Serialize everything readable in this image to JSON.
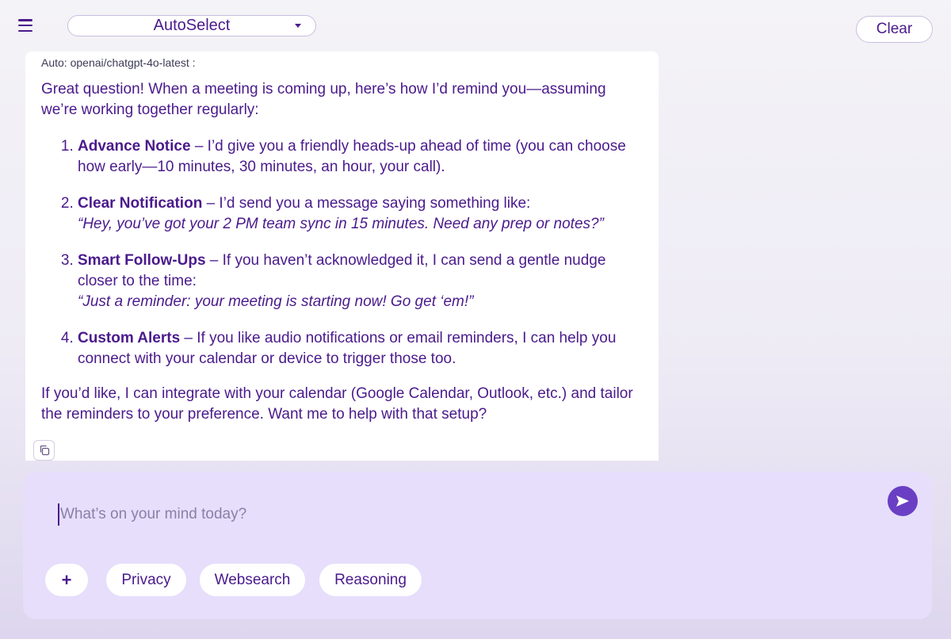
{
  "header": {
    "model_label": "AutoSelect",
    "clear_label": "Clear"
  },
  "message": {
    "model_tag": "Auto: openai/chatgpt-4o-latest :",
    "intro": "Great question! When a meeting is coming up, here’s how I’d remind you—assuming we’re working together regularly:",
    "steps": [
      {
        "title": "Advance Notice",
        "text": " – I’d give you a friendly heads-up ahead of time (you can choose how early—10 minutes, 30 minutes, an hour, your call).",
        "quote": ""
      },
      {
        "title": "Clear Notification",
        "text": " – I’d send you a message saying something like:",
        "quote": "“Hey, you’ve got your 2 PM team sync in 15 minutes. Need any prep or notes?”"
      },
      {
        "title": "Smart Follow-Ups",
        "text": " – If you haven’t acknowledged it, I can send a gentle nudge closer to the time:",
        "quote": "“Just a reminder: your meeting is starting now! Go get ‘em!”"
      },
      {
        "title": "Custom Alerts",
        "text": " – If you like audio notifications or email reminders, I can help you connect with your calendar or device to trigger those too.",
        "quote": ""
      }
    ],
    "outro": "If you’d like, I can integrate with your calendar (Google Calendar, Outlook, etc.) and tailor the reminders to your preference. Want me to help with that setup?"
  },
  "composer": {
    "placeholder": "What’s on your mind today?",
    "value": "",
    "add_label": "+",
    "chips": [
      "Privacy",
      "Websearch",
      "Reasoning"
    ]
  },
  "icons": {
    "menu": "menu-icon",
    "caret": "chevron-down-icon",
    "copy": "copy-icon",
    "send": "send-icon"
  },
  "colors": {
    "accent": "#6a3fc4",
    "text": "#4a1a8c",
    "composer_bg": "#e6defb"
  }
}
